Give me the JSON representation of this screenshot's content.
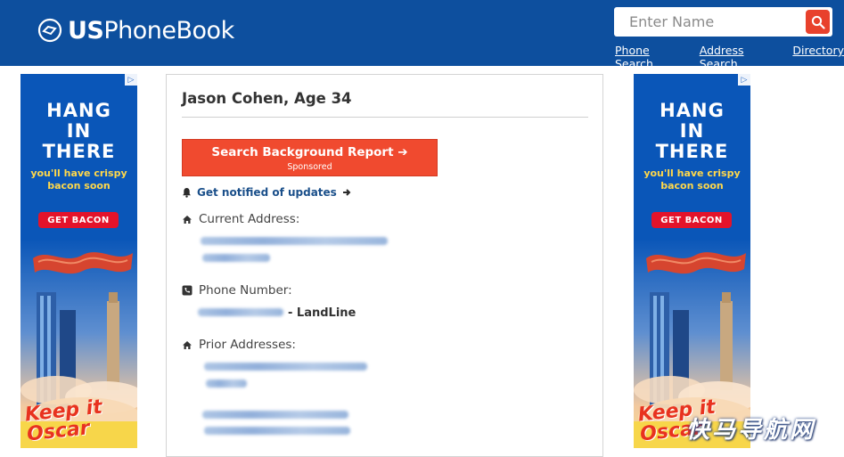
{
  "header": {
    "logo_us": "US",
    "logo_rest": "PhoneBook",
    "search_placeholder": "Enter Name",
    "nav": [
      "Phone Search",
      "Address Search",
      "Directory"
    ]
  },
  "ad": {
    "headline": [
      "HANG",
      "IN",
      "THERE"
    ],
    "sub": [
      "you'll have crispy",
      "bacon soon"
    ],
    "cta": "GET BACON",
    "brand": [
      "Keep it",
      "Oscar"
    ],
    "adchoice": "▷"
  },
  "person": {
    "title": "Jason Cohen, Age 34",
    "report_button": "Search Background Report ➔",
    "report_sub": "Sponsored",
    "notify": "Get notified of updates",
    "current_address_label": "Current Address:",
    "phone_label": "Phone Number:",
    "phone_type": "- LandLine",
    "prior_label": "Prior Addresses:"
  },
  "watermark": "快马导航网",
  "colors": {
    "header_bg": "#0d4f9e",
    "accent": "#f04a2f",
    "ad_bg": "#0a56b8",
    "link": "#1a4f8a"
  }
}
